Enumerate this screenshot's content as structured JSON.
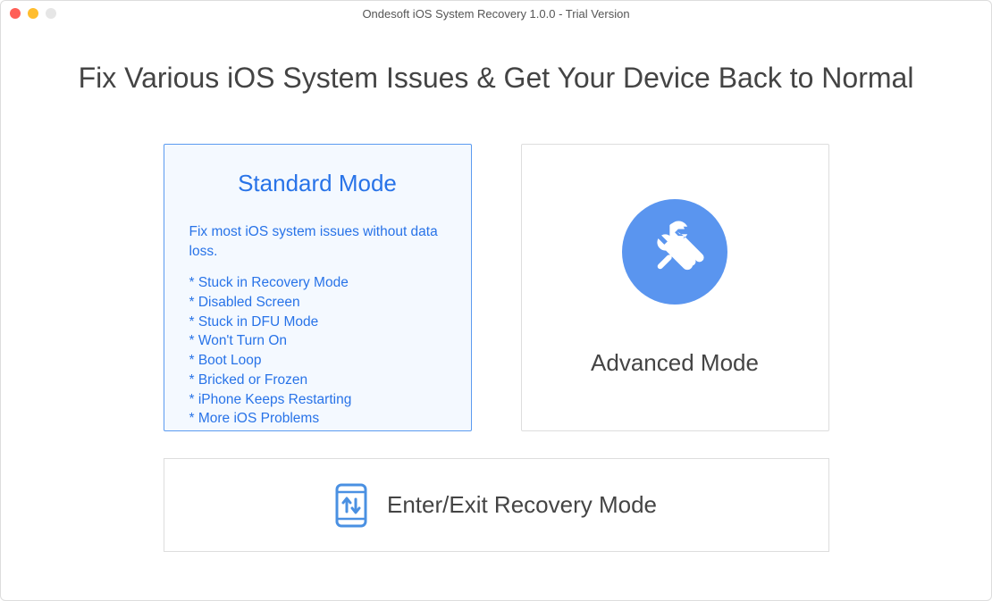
{
  "window": {
    "title": "Ondesoft iOS System Recovery 1.0.0 - Trial Version"
  },
  "heading": "Fix Various iOS System Issues & Get Your Device Back to Normal",
  "standard": {
    "title": "Standard Mode",
    "description": "Fix most iOS system issues without data loss.",
    "items": [
      "Stuck in Recovery Mode",
      "Disabled Screen",
      "Stuck in DFU Mode",
      "Won't Turn On",
      "Boot Loop",
      "Bricked or Frozen",
      "iPhone Keeps Restarting",
      "More iOS Problems"
    ]
  },
  "advanced": {
    "title": "Advanced Mode"
  },
  "recovery": {
    "title": "Enter/Exit Recovery Mode"
  }
}
